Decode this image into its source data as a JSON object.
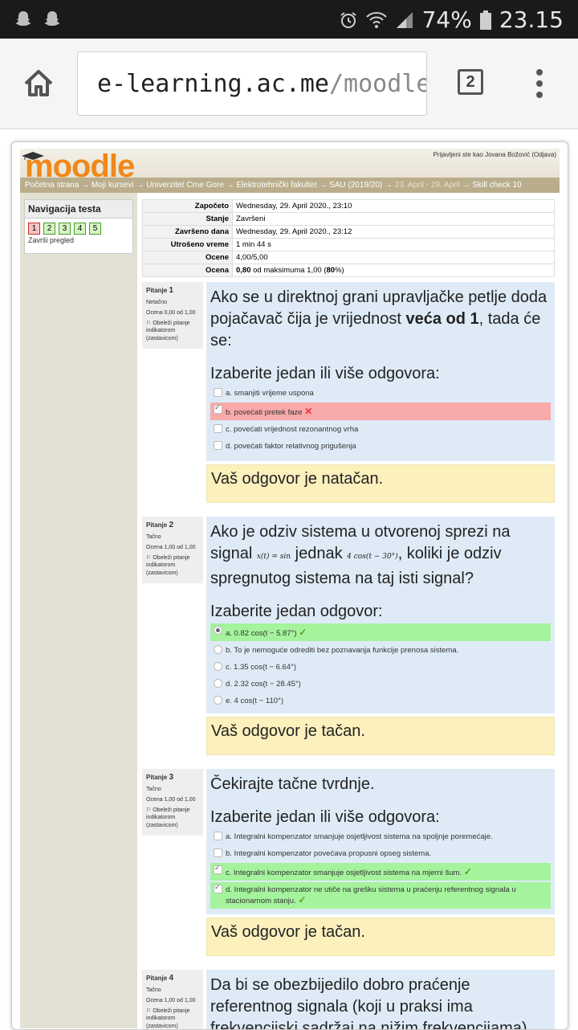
{
  "status_bar": {
    "battery": "74%",
    "time": "23.15"
  },
  "browser": {
    "url_host": "e-learning.ac.me",
    "url_path": "/moodle/mod",
    "tab_count": "2"
  },
  "header": {
    "logo_text": "moodle",
    "login_info": "Prijavljeni ste kao Jovana Božović (Odjava)",
    "breadcrumbs": [
      "Početna strana",
      "Moji kursevi",
      "Univerzitet Crne Gore",
      "Elektrotehnički fakultet",
      "SAU (2019/20)",
      "23. April - 29. April",
      "Skill check 10"
    ]
  },
  "nav": {
    "title": "Navigacija testa",
    "buttons": [
      "1",
      "2",
      "3",
      "4",
      "5"
    ],
    "finish": "Završi pregled"
  },
  "summary": [
    {
      "k": "Započeto",
      "v": "Wednesday, 29. April 2020., 23:10"
    },
    {
      "k": "Stanje",
      "v": "Završeni"
    },
    {
      "k": "Završeno dana",
      "v": "Wednesday, 29. April 2020., 23:12"
    },
    {
      "k": "Utrošeno vreme",
      "v": "1 min 44 s"
    },
    {
      "k": "Ocene",
      "v": "4,00/5,00"
    },
    {
      "k": "Ocena",
      "v_bold": "0,80",
      "v_mid": " od maksimuma 1,00 (",
      "v_pct": "80",
      "v_end": "%)"
    }
  ],
  "question_labels": {
    "pitanje": "Pitanje",
    "flag": "Obeleži pitanje indikatorom (zastavicom)"
  },
  "questions": [
    {
      "num": "1",
      "state": "Netačno",
      "grade": "Ocena 0,00 od 1,00",
      "text_a": "Ako se u direktnoj grani upravljačke petlje doda pojačavač čija je vrijednost ",
      "text_b": "veća od 1",
      "text_c": ", tada će se:",
      "prompt": "Izaberite jedan ili više odgovora:",
      "answers": [
        "a. smanjiti vrijeme uspona",
        "b. povećati pretek faze",
        "c. povećati vrijednost rezonantnog vrha",
        "d. povećati faktor relativnog prigušenja"
      ],
      "feedback": "Vaš odgovor je natačan."
    },
    {
      "num": "2",
      "state": "Tačno",
      "grade": "Ocena 1,00 od 1,00",
      "text_a": "Ako je odziv sistema u otvorenoj sprezi na signal ",
      "math_a": "x(t) = sin",
      "text_b": " jednak ",
      "math_b": "4 cos(t − 30°)",
      "text_c": ", koliki je odziv spregnutog sistema na taj isti signal?",
      "prompt": "Izaberite jedan odgovor:",
      "answers": [
        "a. 0.82 cos(t − 5.87°)",
        "b. To je nemoguće odrediti bez poznavanja funkcije prenosa sistema.",
        "c. 1.35 cos(t − 6.64°)",
        "d. 2.32 cos(t − 28.45°)",
        "e. 4 cos(t − 110°)"
      ],
      "feedback": "Vaš odgovor je tačan."
    },
    {
      "num": "3",
      "state": "Tačno",
      "grade": "Ocena 1,00 od 1,00",
      "text_a": "Čekirajte tačne tvrdnje.",
      "prompt": "Izaberite jedan ili više odgovora:",
      "answers": [
        "a. Integralni kompenzator smanjuje osjetljivost sistema na spoljnje poremećaje.",
        "b. Integralni kompenzator povećava propusni opseg sistema.",
        "c. Integralni kompenzator smanjuje osjetljivost sistema na mjerni šum.",
        "d. Integralni kompenzator ne utiče na grešku sistema u praćenju referentnog signala u stacionarnom stanju."
      ],
      "feedback": "Vaš odgovor je tačan."
    },
    {
      "num": "4",
      "state": "Tačno",
      "grade": "Ocena 1,00 od 1,00",
      "text_a": "Da bi se obezbijedilo dobro praćenje referentnog signala (koji u praksi ima frekvencijski sadržaj na nižim frekvencijama)"
    }
  ]
}
